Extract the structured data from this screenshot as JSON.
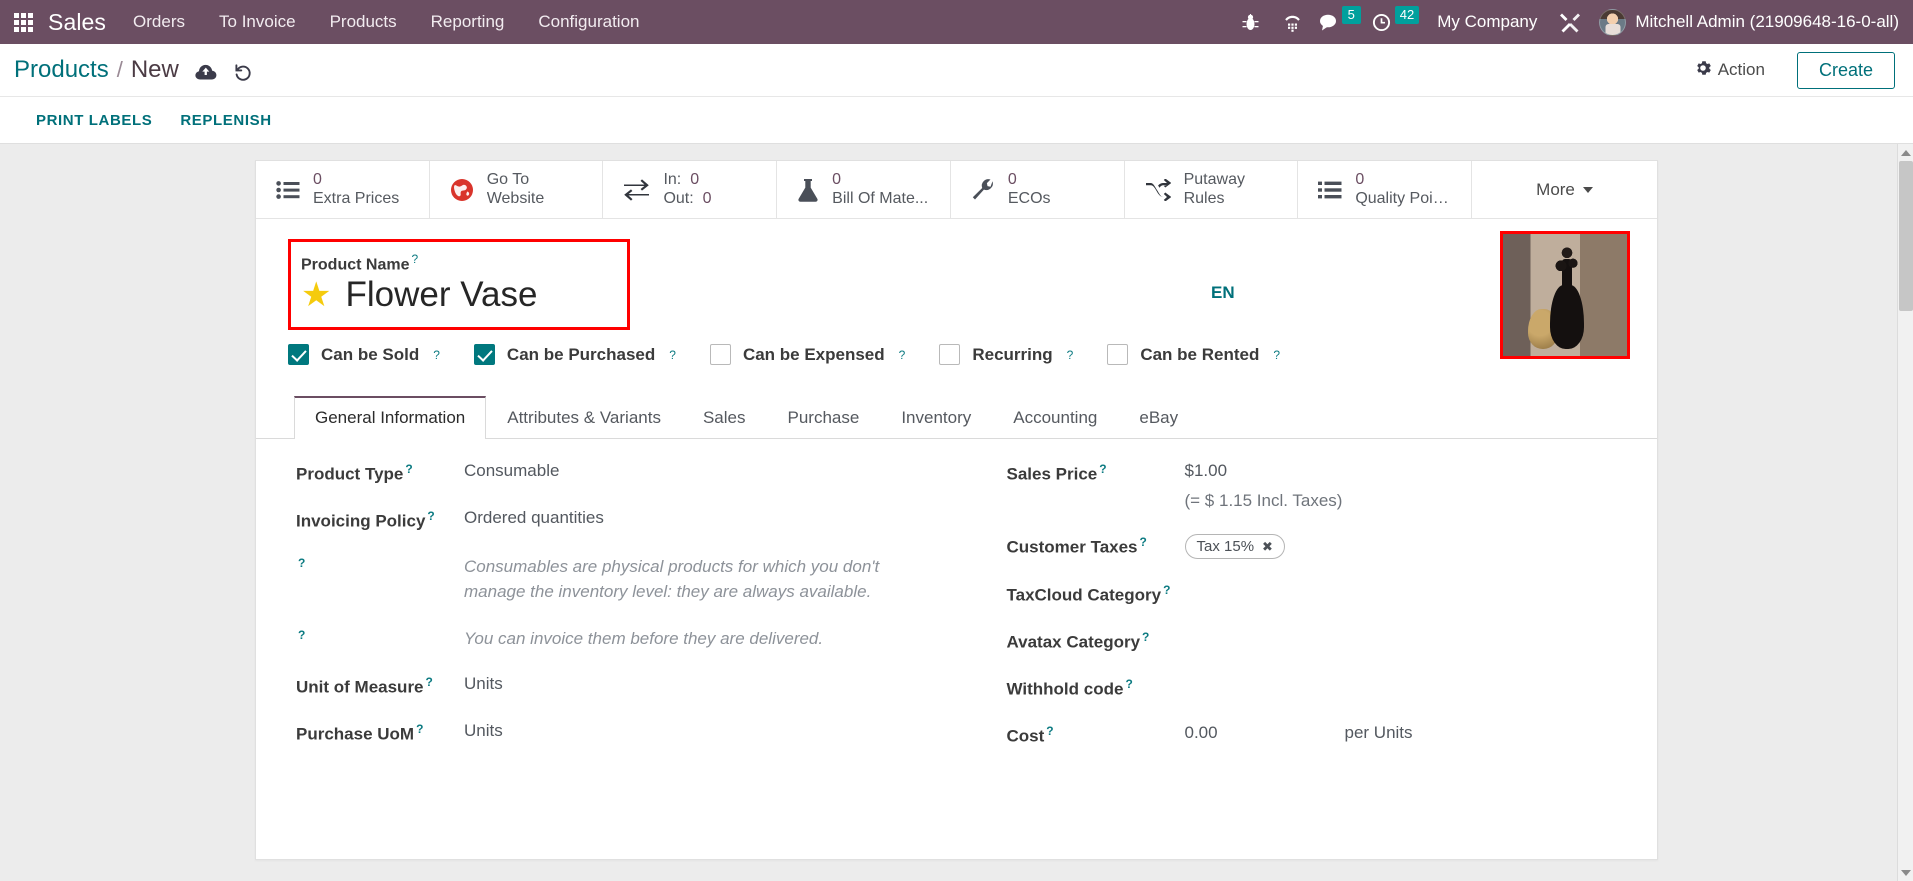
{
  "navbar": {
    "apps_icon": "apps-grid-icon",
    "brand": "Sales",
    "menus": [
      "Orders",
      "To Invoice",
      "Products",
      "Reporting",
      "Configuration"
    ],
    "icons": [
      {
        "name": "bug-icon",
        "glyph": "bug"
      },
      {
        "name": "phone-keypad-icon",
        "glyph": "phone"
      }
    ],
    "messages": {
      "icon": "chat-bubble-icon",
      "count": "5"
    },
    "activities": {
      "icon": "clock-icon",
      "count": "42"
    },
    "company": "My Company",
    "settings_icon": "tools-icon",
    "user": "Mitchell Admin (21909648-16-0-all)",
    "avatar": "user-avatar",
    "bg_color": "#6b4e62",
    "badge_color": "#00a09d"
  },
  "control_panel": {
    "breadcrumb_root": "Products",
    "breadcrumb_sep": "/",
    "breadcrumb_current": "New",
    "save_icon": "cloud-upload-icon",
    "discard_icon": "undo-icon",
    "action_label": "Action",
    "action_icon": "gear-icon",
    "create_label": "Create",
    "buttons": [
      "PRINT LABELS",
      "REPLENISH"
    ],
    "accent_color": "#00707a"
  },
  "stat_buttons": [
    {
      "name": "extra-prices",
      "icon": "list-bullet-icon",
      "value": "0",
      "label": "Extra Prices"
    },
    {
      "name": "go-to-website",
      "icon": "globe-icon",
      "value": "Go To",
      "label": "Website"
    },
    {
      "name": "in-out",
      "icon": "exchange-arrows-icon",
      "in_key": "In:",
      "in_val": "0",
      "out_key": "Out:",
      "out_val": "0"
    },
    {
      "name": "bill-of-materials",
      "icon": "flask-icon",
      "value": "0",
      "label": "Bill Of Mate..."
    },
    {
      "name": "ecos",
      "icon": "wrench-icon",
      "value": "0",
      "label": "ECOs"
    },
    {
      "name": "putaway-rules",
      "icon": "shuffle-icon",
      "value": "Putaway",
      "label": "Rules"
    },
    {
      "name": "quality-points",
      "icon": "list-bullet-icon",
      "value": "0",
      "label": "Quality Points"
    }
  ],
  "more_button": {
    "label": "More",
    "icon": "caret-down-icon"
  },
  "title": {
    "label": "Product Name",
    "value": "Flower Vase",
    "favorite_icon": "star-icon",
    "favorite_color": "#f5cb0d",
    "highlight_color": "#ff0000",
    "language": "EN",
    "image_name": "product-image-flower-vase"
  },
  "checkboxes": [
    {
      "name": "can-be-sold",
      "label": "Can be Sold",
      "checked": true
    },
    {
      "name": "can-be-purchased",
      "label": "Can be Purchased",
      "checked": true
    },
    {
      "name": "can-be-expensed",
      "label": "Can be Expensed",
      "checked": false
    },
    {
      "name": "recurring",
      "label": "Recurring",
      "checked": false
    },
    {
      "name": "can-be-rented",
      "label": "Can be Rented",
      "checked": false
    }
  ],
  "tabs": [
    {
      "name": "general-information",
      "label": "General Information",
      "active": true
    },
    {
      "name": "attributes-variants",
      "label": "Attributes & Variants",
      "active": false
    },
    {
      "name": "sales",
      "label": "Sales",
      "active": false
    },
    {
      "name": "purchase",
      "label": "Purchase",
      "active": false
    },
    {
      "name": "inventory",
      "label": "Inventory",
      "active": false
    },
    {
      "name": "accounting",
      "label": "Accounting",
      "active": false
    },
    {
      "name": "ebay",
      "label": "eBay",
      "active": false
    }
  ],
  "left_fields": {
    "product_type_label": "Product Type",
    "product_type_value": "Consumable",
    "invoicing_policy_label": "Invoicing Policy",
    "invoicing_policy_value": "Ordered quantities",
    "note_1": "Consumables are physical products for which you don't manage the inventory level: they are always available.",
    "note_2": "You can invoice them before they are delivered.",
    "uom_label": "Unit of Measure",
    "uom_value": "Units",
    "purchase_uom_label": "Purchase UoM",
    "purchase_uom_value": "Units"
  },
  "right_fields": {
    "sales_price_label": "Sales Price",
    "sales_price_value": "$1.00",
    "sales_price_incl": "(= $ 1.15 Incl. Taxes)",
    "customer_taxes_label": "Customer Taxes",
    "customer_taxes_tag": "Tax 15%",
    "taxcloud_label": "TaxCloud Category",
    "taxcloud_value": "",
    "avatax_label": "Avatax Category",
    "avatax_value": "",
    "withhold_label": "Withhold code",
    "withhold_value": "",
    "cost_label": "Cost",
    "cost_value": "0.00",
    "cost_unit": "per Units"
  }
}
